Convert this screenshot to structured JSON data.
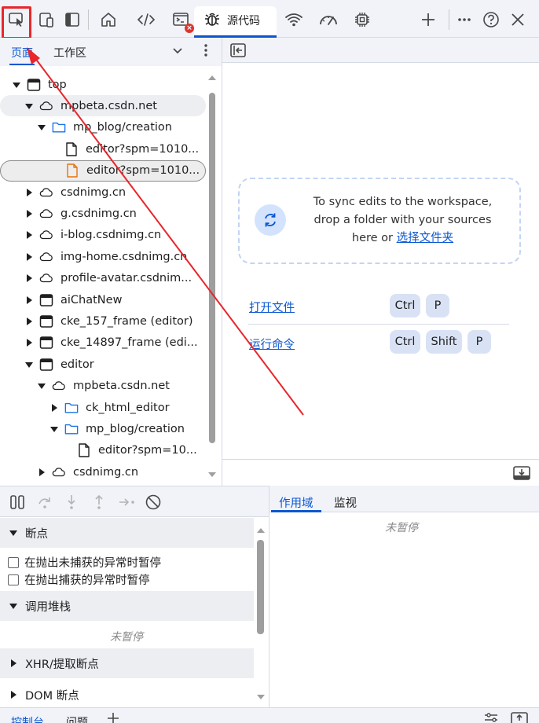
{
  "toolbar": {
    "sources_tab_label": "源代码",
    "error_count": "×",
    "icons": [
      "inspect-element-icon",
      "device-toolbar-icon",
      "dock-side-icon",
      "elements-home-icon",
      "code-icon",
      "console-icon",
      "bug-icon",
      "network-wifi-icon",
      "performance-gauge-icon",
      "memory-chip-icon",
      "add-icon",
      "more-icon",
      "help-icon",
      "close-icon"
    ]
  },
  "navigator": {
    "tab_page": "页面",
    "tab_workspace": "工作区",
    "tree": [
      {
        "label": "top",
        "icon": "frame-icon",
        "depth": 0,
        "arrow": "down"
      },
      {
        "label": "mpbeta.csdn.net",
        "icon": "cloud-icon",
        "depth": 1,
        "arrow": "down"
      },
      {
        "label": "mp_blog/creation",
        "icon": "folder-icon",
        "depth": 2,
        "arrow": "down"
      },
      {
        "label": "editor?spm=1010...",
        "icon": "file-icon",
        "depth": 3,
        "arrow": "none"
      },
      {
        "label": "editor?spm=1010...",
        "icon": "file-orange-icon",
        "depth": 3,
        "arrow": "none"
      },
      {
        "label": "csdnimg.cn",
        "icon": "cloud-icon",
        "depth": 1,
        "arrow": "right"
      },
      {
        "label": "g.csdnimg.cn",
        "icon": "cloud-icon",
        "depth": 1,
        "arrow": "right"
      },
      {
        "label": "i-blog.csdnimg.cn",
        "icon": "cloud-icon",
        "depth": 1,
        "arrow": "right"
      },
      {
        "label": "img-home.csdnimg.cn",
        "icon": "cloud-icon",
        "depth": 1,
        "arrow": "right"
      },
      {
        "label": "profile-avatar.csdnim...",
        "icon": "cloud-icon",
        "depth": 1,
        "arrow": "right"
      },
      {
        "label": "aiChatNew",
        "icon": "frame-icon",
        "depth": 1,
        "arrow": "right"
      },
      {
        "label": "cke_157_frame (editor)",
        "icon": "frame-icon",
        "depth": 1,
        "arrow": "right"
      },
      {
        "label": "cke_14897_frame (edi...",
        "icon": "frame-icon",
        "depth": 1,
        "arrow": "right"
      },
      {
        "label": "editor",
        "icon": "frame-icon",
        "depth": 1,
        "arrow": "down"
      },
      {
        "label": "mpbeta.csdn.net",
        "icon": "cloud-icon",
        "depth": 2,
        "arrow": "down"
      },
      {
        "label": "ck_html_editor",
        "icon": "folder-icon",
        "depth": 3,
        "arrow": "right"
      },
      {
        "label": "mp_blog/creation",
        "icon": "folder-icon",
        "depth": 3,
        "arrow": "down"
      },
      {
        "label": "editor?spm=10...",
        "icon": "file-icon",
        "depth": 4,
        "arrow": "none"
      },
      {
        "label": "csdnimg.cn",
        "icon": "cloud-icon",
        "depth": 2,
        "arrow": "right"
      }
    ]
  },
  "editor": {
    "sync_text_1": "To sync edits to the workspace,",
    "sync_text_2": "drop a folder with your sources",
    "sync_text_3": "here or ",
    "sync_link": "选择文件夹",
    "open_file_label": "打开文件",
    "open_file_keys": [
      "Ctrl",
      "P"
    ],
    "run_command_label": "运行命令",
    "run_command_keys": [
      "Ctrl",
      "Shift",
      "P"
    ]
  },
  "debugger": {
    "breakpoints_header": "断点",
    "pause_uncaught": "在抛出未捕获的异常时暂停",
    "pause_caught": "在抛出捕获的异常时暂停",
    "callstack_header": "调用堆栈",
    "callstack_empty": "未暂停",
    "xhr_header": "XHR/提取断点",
    "dom_header": "DOM 断点"
  },
  "scope": {
    "tab_scope": "作用域",
    "tab_watch": "监视",
    "empty": "未暂停"
  },
  "drawer": {
    "tab_console": "控制台",
    "tab_issues": "问题"
  },
  "colors": {
    "accent": "#0b57d0",
    "annotation": "#e8262b",
    "toolbar_bg": "#f1f3f9"
  }
}
